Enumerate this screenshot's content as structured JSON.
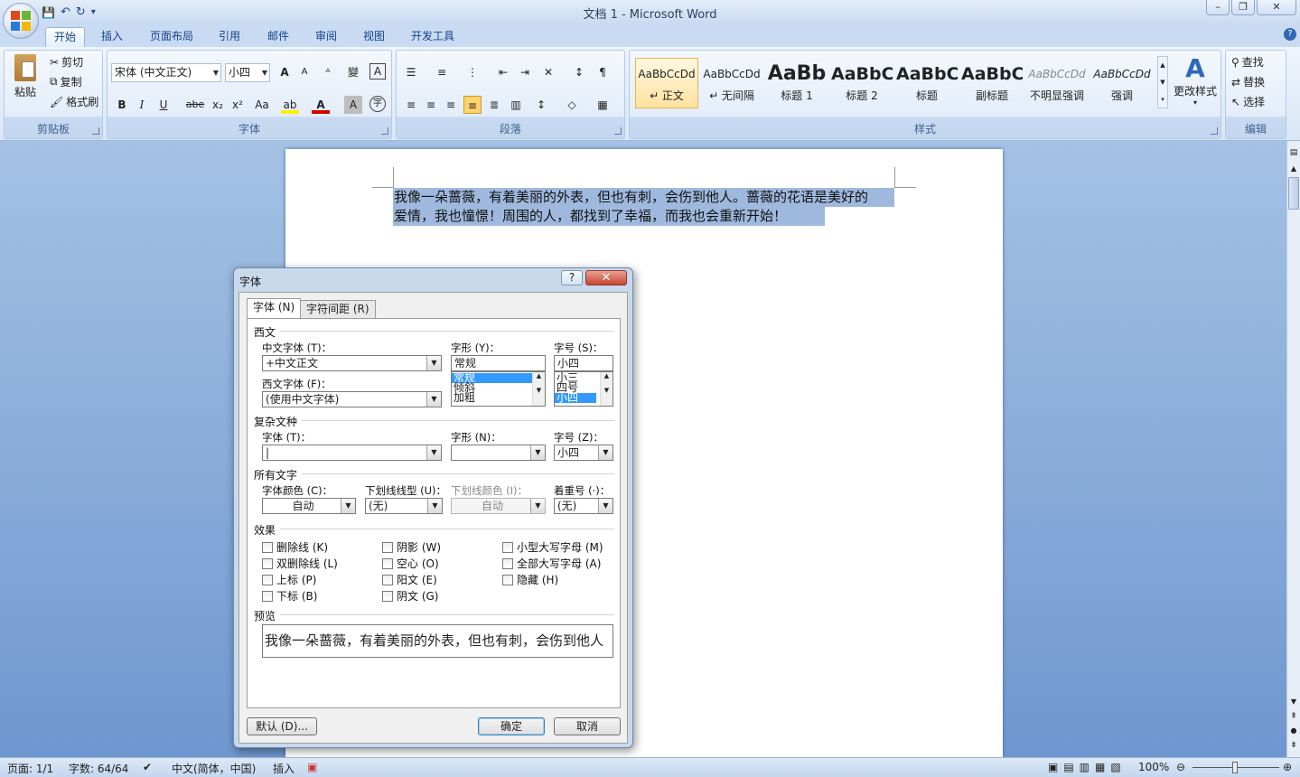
{
  "window": {
    "title": "文档 1 - Microsoft Word",
    "minimize": "–",
    "maximize": "❐",
    "close": "✕"
  },
  "qat": {
    "save": "💾",
    "undo": "↶",
    "redo": "↻",
    "more": "▾"
  },
  "ribbon": {
    "tabs": [
      "开始",
      "插入",
      "页面布局",
      "引用",
      "邮件",
      "审阅",
      "视图",
      "开发工具"
    ],
    "help": "?",
    "clipboard": {
      "label": "剪贴板",
      "paste": "粘贴",
      "cut": "剪切",
      "copy": "复制",
      "format_painter": "格式刷"
    },
    "font": {
      "label": "字体",
      "font_name": "宋体 (中文正文)",
      "font_size": "小四",
      "grow": "A",
      "shrink": "A",
      "clear": "ᴬ",
      "phonetic": "變",
      "border": "A",
      "bold": "B",
      "italic": "I",
      "underline": "U",
      "strike": "abe",
      "sub": "x₂",
      "sup": "x²",
      "case": "Aa",
      "highlight": "ab",
      "color": "A",
      "shade": "A",
      "enclose": "字"
    },
    "paragraph": {
      "label": "段落"
    },
    "styles": {
      "label": "样式",
      "items": [
        {
          "preview": "AaBbCcDd",
          "name": "↵ 正文"
        },
        {
          "preview": "AaBbCcDd",
          "name": "↵ 无间隔"
        },
        {
          "preview": "AaBb",
          "name": "标题 1"
        },
        {
          "preview": "AaBbC",
          "name": "标题 2"
        },
        {
          "preview": "AaBbC",
          "name": "标题"
        },
        {
          "preview": "AaBbC",
          "name": "副标题"
        },
        {
          "preview": "AaBbCcDd",
          "name": "不明显强调"
        },
        {
          "preview": "AaBbCcDd",
          "name": "强调"
        }
      ],
      "change": "更改样式"
    },
    "editing": {
      "label": "编辑",
      "find": "查找",
      "replace": "替换",
      "select": "选择"
    }
  },
  "document": {
    "line1": "我像一朵蔷薇，有着美丽的外表，但也有刺，会伤到他人。蔷薇的花语是美好的",
    "line2": "爱情，我也憧憬！周围的人，都找到了幸福，而我也会重新开始！"
  },
  "dialog": {
    "title": "字体",
    "help": "?",
    "close": "✕",
    "tabs": [
      "字体 (N)",
      "字符间距 (R)"
    ],
    "western": {
      "section": "西文",
      "cn_font_label": "中文字体 (T)：",
      "cn_font": "+中文正文",
      "west_font_label": "西文字体 (F)：",
      "west_font": "(使用中文字体)",
      "style_label": "字形 (Y)：",
      "style_value": "常规",
      "style_list": [
        "常规",
        "倾斜",
        "加粗"
      ],
      "size_label": "字号 (S)：",
      "size_value": "小四",
      "size_list": [
        "小三",
        "四号",
        "小四"
      ]
    },
    "complex": {
      "section": "复杂文种",
      "font_label": "字体 (T)：",
      "font": "",
      "style_label": "字形 (N)：",
      "style": "",
      "size_label": "字号 (Z)：",
      "size": "小四"
    },
    "all": {
      "section": "所有文字",
      "color_label": "字体颜色 (C)：",
      "color": "自动",
      "underline_label": "下划线线型 (U)：",
      "underline": "(无)",
      "ucolor_label": "下划线颜色 (I)：",
      "ucolor": "自动",
      "emphasis_label": "着重号 (·)：",
      "emphasis": "(无)"
    },
    "effects": {
      "section": "效果",
      "items": [
        "删除线 (K)",
        "阴影 (W)",
        "小型大写字母 (M)",
        "双删除线 (L)",
        "空心 (O)",
        "全部大写字母 (A)",
        "上标 (P)",
        "阳文 (E)",
        "隐藏 (H)",
        "下标 (B)",
        "阴文 (G)"
      ]
    },
    "preview": {
      "section": "预览",
      "text": "我像一朵蔷薇，有着美丽的外表，但也有刺，会伤到他人"
    },
    "buttons": {
      "default": "默认 (D)...",
      "ok": "确定",
      "cancel": "取消"
    }
  },
  "status": {
    "page": "页面: 1/1",
    "words": "字数: 64/64",
    "lang": "中文(简体，中国)",
    "mode": "插入",
    "zoom": "100%"
  }
}
